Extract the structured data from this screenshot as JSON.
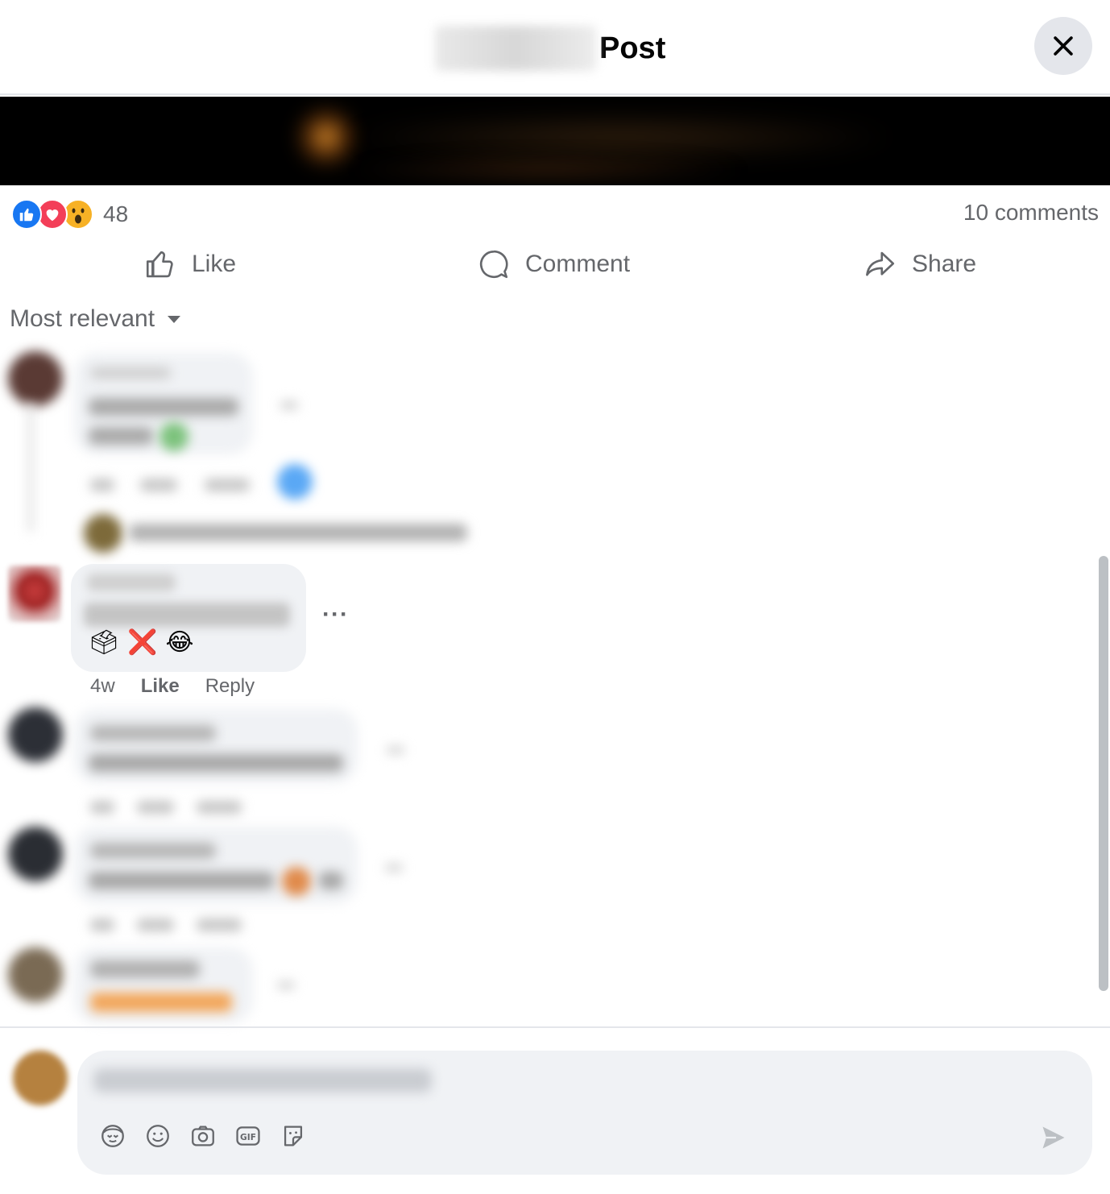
{
  "header": {
    "title": "Post",
    "close_icon": "close-icon"
  },
  "reactions": {
    "icons": [
      "like-reaction-icon",
      "love-reaction-icon",
      "wow-reaction-icon"
    ],
    "count": "48",
    "comments_count": "10 comments"
  },
  "actions": {
    "like": "Like",
    "comment": "Comment",
    "share": "Share"
  },
  "sort": {
    "label": "Most relevant"
  },
  "visible_comment": {
    "emojis": [
      "🗳",
      "❌",
      "😂"
    ],
    "time": "4w",
    "like": "Like",
    "reply": "Reply",
    "more": "···"
  },
  "composer": {
    "tools": [
      "avatar-sticker-icon",
      "emoji-icon",
      "camera-icon",
      "gif-icon",
      "sticker-icon"
    ],
    "send_icon": "send-icon"
  },
  "colors": {
    "accent": "#1877f2",
    "love": "#f33e58",
    "wow": "#f7b125",
    "secondary_text": "#65676b",
    "bubble": "#f0f2f5"
  }
}
